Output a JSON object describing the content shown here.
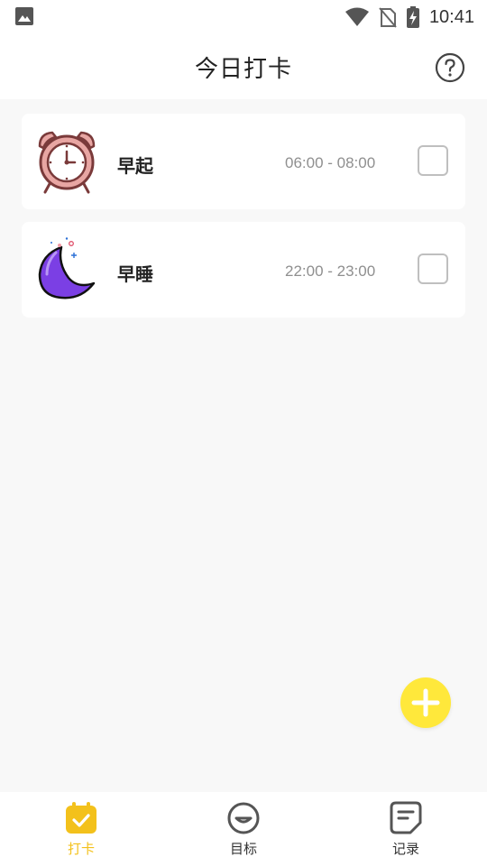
{
  "status_bar": {
    "time": "10:41",
    "icons": [
      "image-icon",
      "wifi-icon",
      "no-sim-icon",
      "battery-charging-icon"
    ]
  },
  "header": {
    "title": "今日打卡",
    "help_icon": "help-circle-icon"
  },
  "habits": [
    {
      "name": "早起",
      "time": "06:00 - 08:00",
      "icon": "alarm-clock-icon",
      "checked": false
    },
    {
      "name": "早睡",
      "time": "22:00 - 23:00",
      "icon": "moon-icon",
      "checked": false
    }
  ],
  "fab": {
    "icon": "plus-icon"
  },
  "bottom_nav": {
    "items": [
      {
        "label": "打卡",
        "icon": "calendar-check-icon",
        "active": true
      },
      {
        "label": "目标",
        "icon": "target-smile-icon",
        "active": false
      },
      {
        "label": "记录",
        "icon": "record-note-icon",
        "active": false
      }
    ]
  },
  "colors": {
    "accent": "#f3c11b",
    "fab": "#ffe83b",
    "background": "#f8f8f8",
    "moon": "#7b3fe4",
    "clock": "#e8a6a3"
  }
}
